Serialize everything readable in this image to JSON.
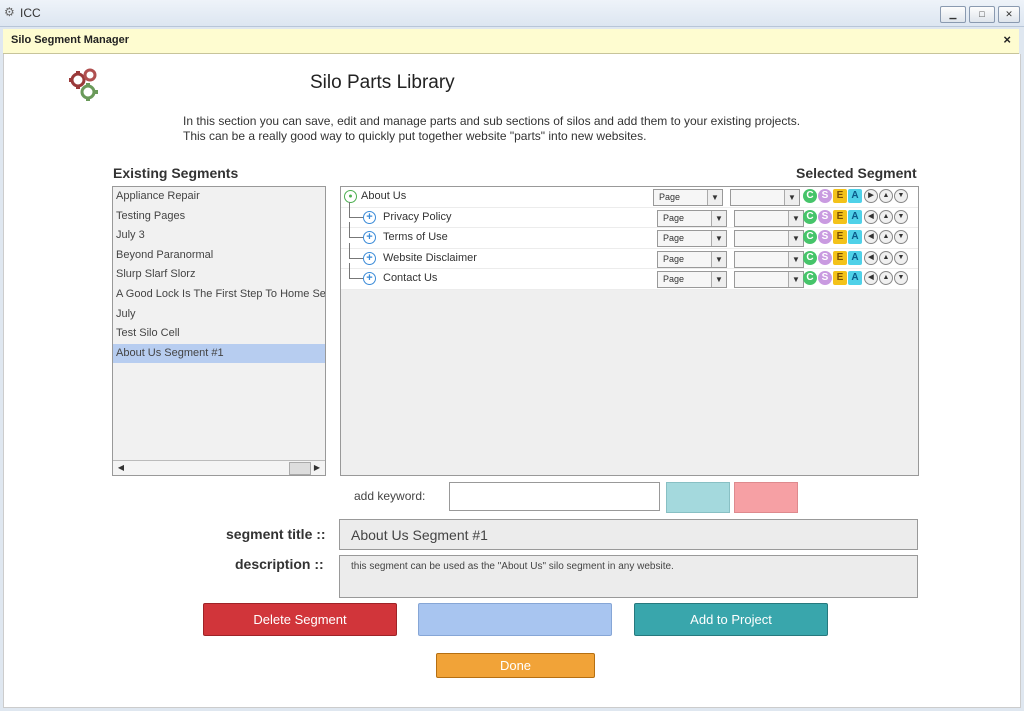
{
  "window": {
    "app_title": "ICC",
    "dialog_title": "Silo Segment Manager",
    "close_symbol": "×"
  },
  "header": {
    "title": "Silo Parts Library",
    "intro_line1": "In this section you can save, edit and manage parts and sub sections of silos and add them to your existing projects.",
    "intro_line2": "This can be a really good way to quickly put together website \"parts\" into new websites."
  },
  "existing": {
    "heading": "Existing Segments",
    "items": [
      "Appliance Repair",
      "Testing Pages",
      "July 3",
      "Beyond Paranormal",
      "Slurp Slarf Slorz",
      "A Good Lock Is The First Step To Home Security",
      "July",
      "Test Silo Cell",
      "About Us Segment #1"
    ],
    "selected_index": 8
  },
  "selected": {
    "heading": "Selected Segment",
    "rows": [
      {
        "label": "About Us",
        "type": "Page",
        "option": ""
      },
      {
        "label": "Privacy Policy",
        "type": "Page",
        "option": ""
      },
      {
        "label": "Terms of Use",
        "type": "Page",
        "option": ""
      },
      {
        "label": "Website Disclaimer",
        "type": "Page",
        "option": ""
      },
      {
        "label": "Contact Us",
        "type": "Page",
        "option": ""
      }
    ],
    "row_icons": [
      "C",
      "S",
      "E",
      "A"
    ]
  },
  "keyword": {
    "label": "add keyword:",
    "value": ""
  },
  "form": {
    "title_label": "segment title ::",
    "title_value": "About Us Segment #1",
    "desc_label": "description ::",
    "desc_value": "this segment can be used as the \"About Us\" silo segment in any website."
  },
  "buttons": {
    "delete": "Delete Segment",
    "middle": "",
    "add": "Add to Project",
    "done": "Done"
  },
  "colors": {
    "delete": "#d1353a",
    "middle": "#a8c5f0",
    "add": "#39a6ac",
    "done": "#f1a338",
    "kw_teal": "#a4d9dd",
    "kw_pink": "#f6a0a4",
    "selection": "#b7cdf0"
  }
}
